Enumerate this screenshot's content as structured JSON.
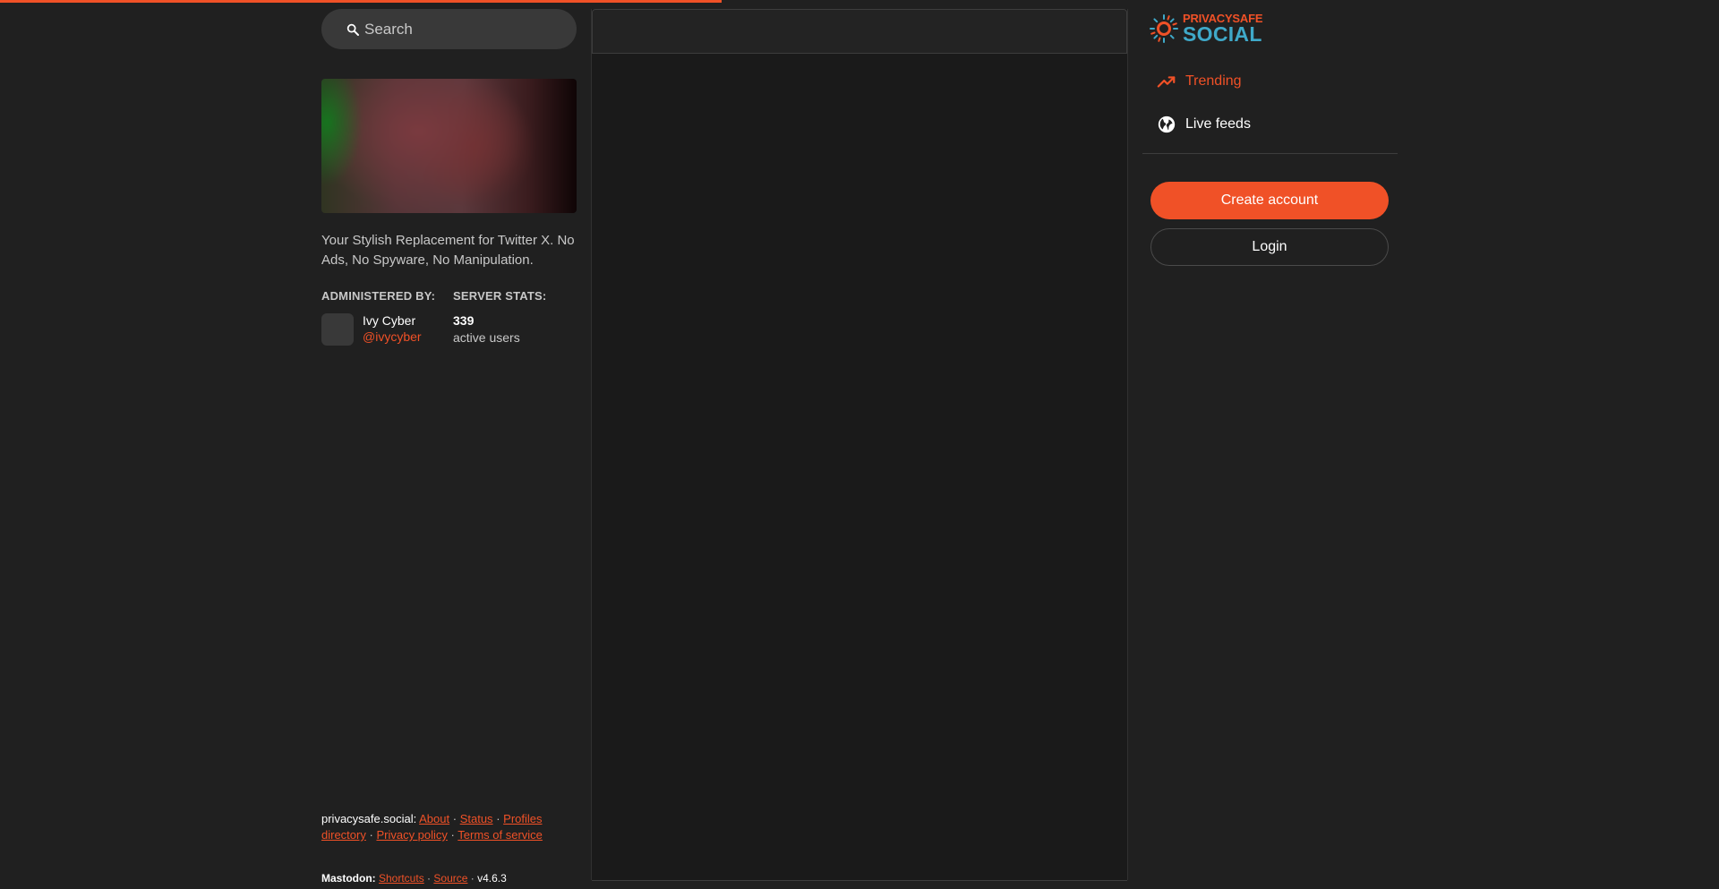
{
  "loading_bar": {
    "progress": 0.42,
    "color": "#f05127"
  },
  "search": {
    "placeholder": "Search"
  },
  "server": {
    "description": "Your Stylish Replacement for Twitter X. No Ads, No Spyware, No Manipulation.",
    "admin_label": "ADMINISTERED BY:",
    "stats_label": "SERVER STATS:",
    "admin": {
      "name": "Ivy Cyber",
      "handle": "@ivycyber"
    },
    "stats": {
      "value": "339",
      "label": "active users"
    }
  },
  "footer": {
    "site": "privacysafe.social:",
    "links": [
      "About",
      "Status",
      "Profiles directory",
      "Privacy policy",
      "Terms of service"
    ],
    "mastodon_label": "Mastodon:",
    "mastodon_links": [
      "Shortcuts",
      "Source"
    ],
    "version": "v4.6.3"
  },
  "logo": {
    "top": "PRIVACYSAFE",
    "bottom": "SOCIAL"
  },
  "nav": {
    "trending": {
      "label": "Trending",
      "icon": "trending-icon"
    },
    "live": {
      "label": "Live feeds",
      "icon": "globe-icon"
    }
  },
  "auth": {
    "create": "Create account",
    "login": "Login"
  },
  "colors": {
    "accent": "#f05127",
    "background": "#202020",
    "logo_blue": "#3fa9c9"
  }
}
